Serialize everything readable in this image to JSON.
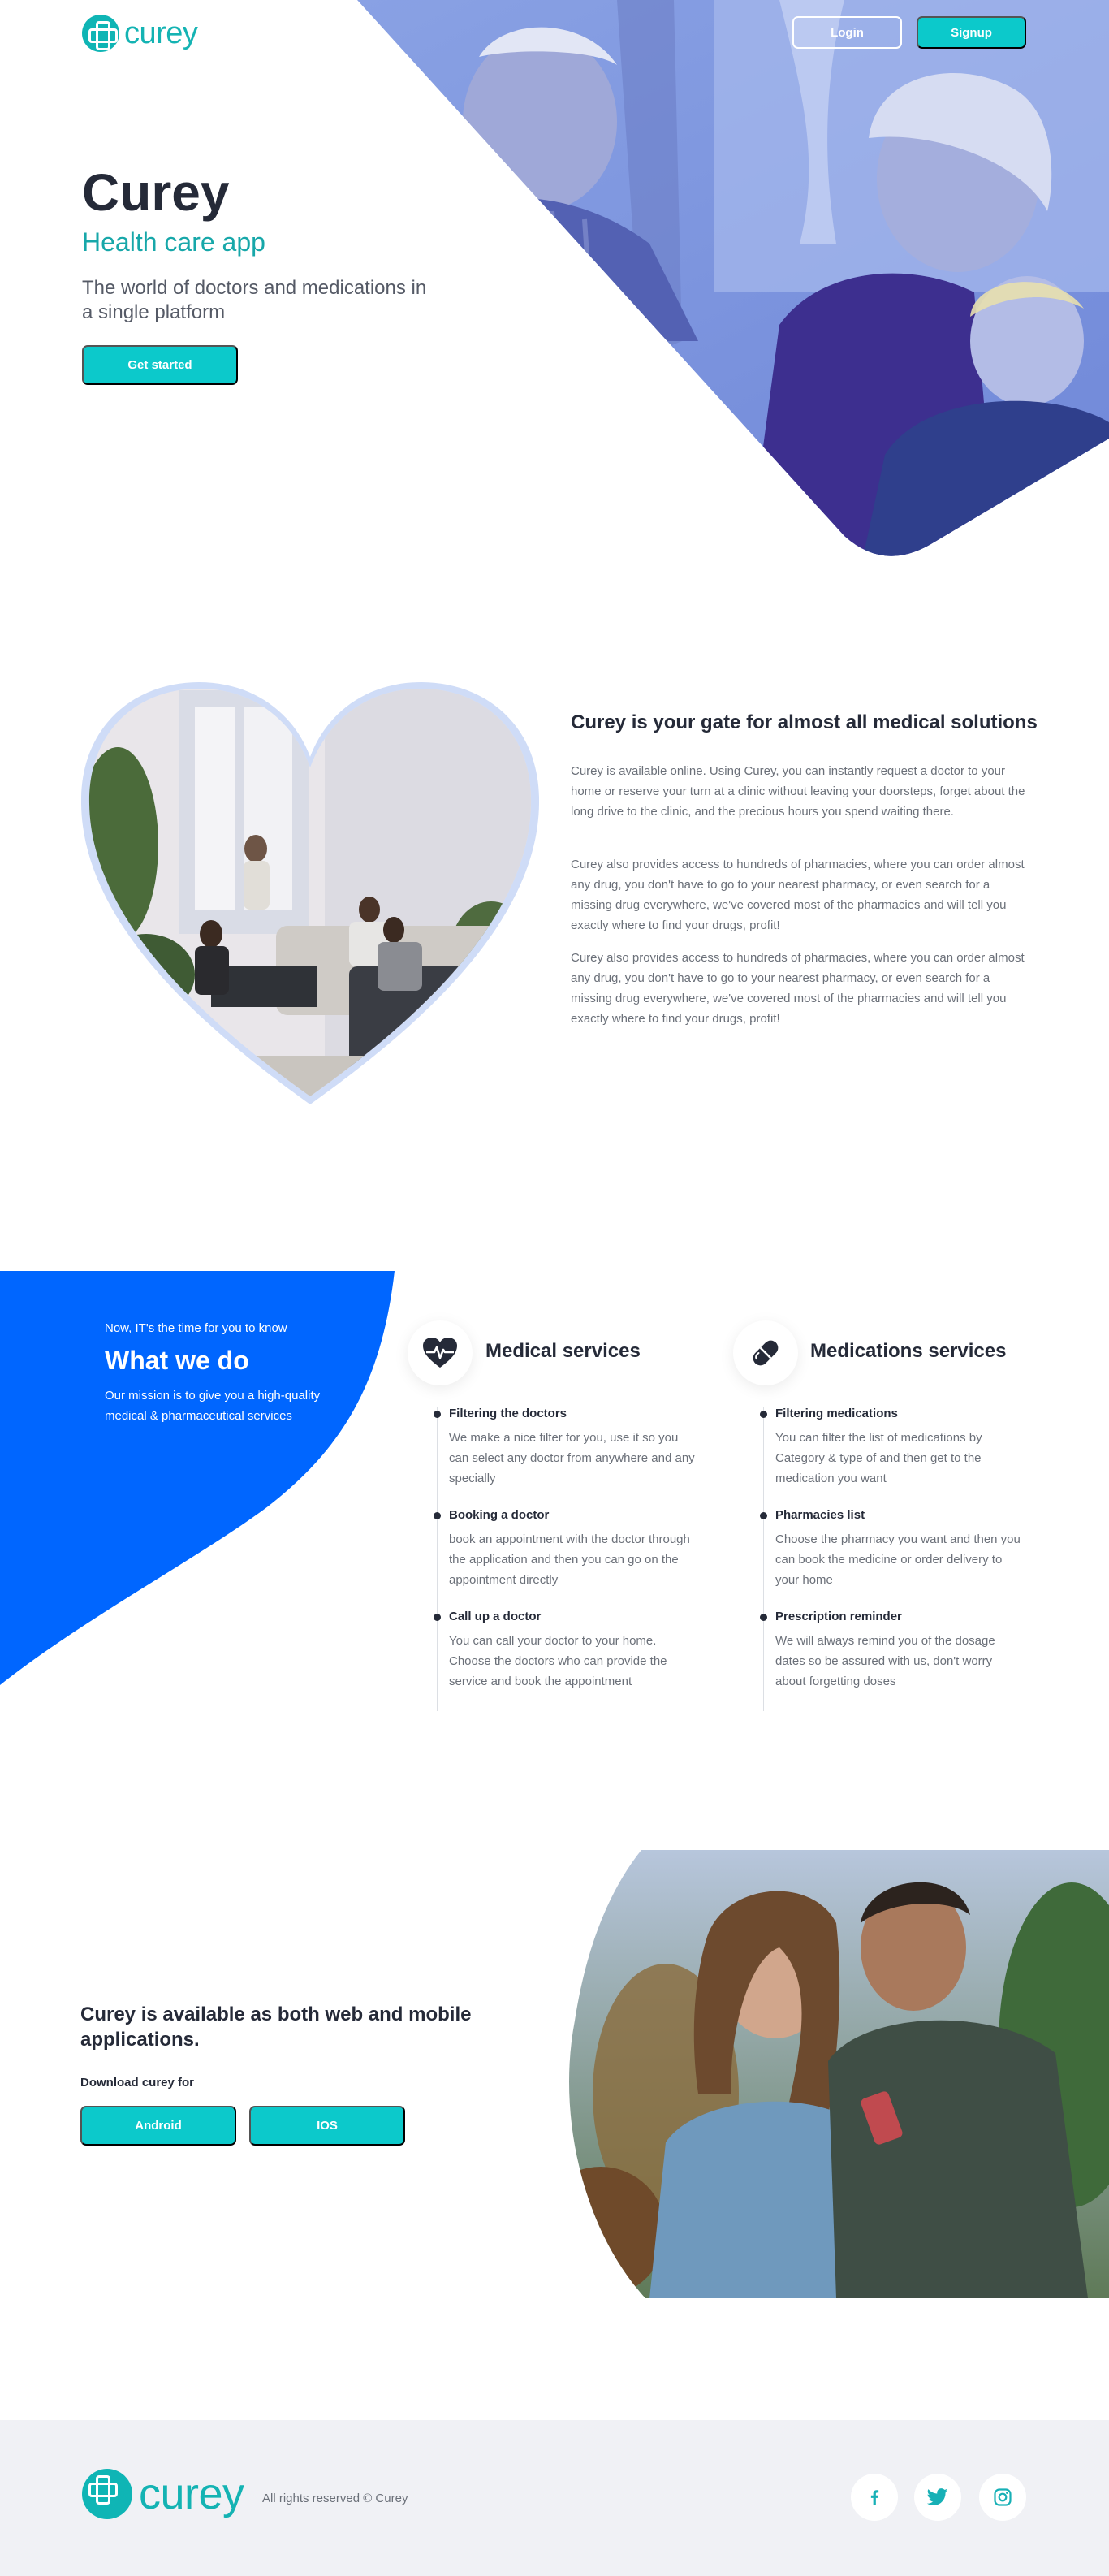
{
  "brand": {
    "name": "curey",
    "accent": "#0cc9cb",
    "blue": "#0066ff",
    "dark": "#252a38"
  },
  "header": {
    "login_label": "Login",
    "signup_label": "Signup"
  },
  "hero": {
    "title": "Curey",
    "subtitle": "Health care app",
    "description": "The world of doctors and medications in a single platform",
    "cta_label": "Get started"
  },
  "about": {
    "title": "Curey is your gate for almost all medical solutions",
    "paragraphs": [
      "Curey is available online. Using Curey, you can instantly request a doctor to your home or reserve your turn at a clinic without leaving your doorsteps, forget about the long drive to the clinic, and the precious hours you spend waiting there.",
      "Curey also provides access to hundreds of pharmacies, where you can order almost any drug, you don't have to go to your nearest pharmacy, or even search for a missing drug everywhere, we've covered most of the pharmacies and will tell you exactly where to find your drugs, profit!",
      "Curey also provides access to hundreds of pharmacies, where you can order almost any drug, you don't have to go to your nearest pharmacy, or even search for a missing drug everywhere, we've covered most of the pharmacies and will tell you exactly where to find your drugs, profit!"
    ]
  },
  "what_we_do": {
    "kicker": "Now, IT's the time for you to know",
    "title": "What we do",
    "description": "Our mission is to give you a high-quality medical & pharmaceutical services",
    "services": [
      {
        "icon": "heart-pulse-icon",
        "title": "Medical services",
        "items": [
          {
            "title": "Filtering the doctors",
            "desc": "We make a nice filter for you, use it so you can select any doctor from anywhere and any specially"
          },
          {
            "title": "Booking a doctor",
            "desc": "book an appointment with the doctor through the application and then you can go on the appointment directly"
          },
          {
            "title": "Call up a doctor",
            "desc": "You can call your doctor to your home. Choose the doctors who can provide the service and book the appointment"
          }
        ]
      },
      {
        "icon": "pill-icon",
        "title": "Medications services",
        "items": [
          {
            "title": "Filtering medications",
            "desc": "You can filter the list of medications by Category & type of and then get to the medication you want"
          },
          {
            "title": "Pharmacies list",
            "desc": "Choose the pharmacy you want and then you can book the medicine or order delivery to your home"
          },
          {
            "title": "Prescription reminder",
            "desc": "We will always remind you of the dosage dates so be assured with us, don't worry about forgetting doses"
          }
        ]
      }
    ]
  },
  "download": {
    "title": "Curey is available as both web and mobile applications.",
    "label": "Download curey for",
    "android_label": "Android",
    "ios_label": "IOS"
  },
  "footer": {
    "copyright": "All rights reserved © Curey",
    "social": [
      "facebook-icon",
      "twitter-icon",
      "instagram-icon"
    ]
  }
}
